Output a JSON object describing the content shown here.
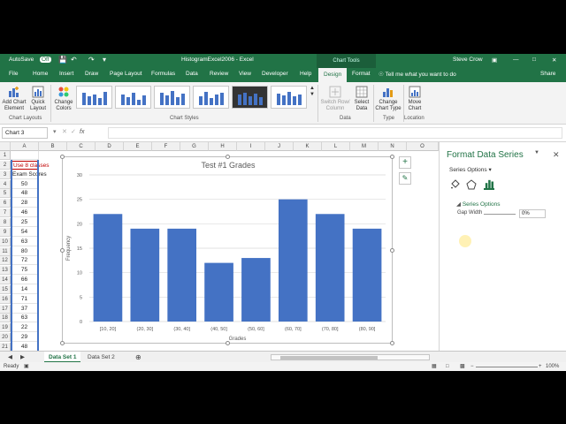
{
  "window": {
    "autosave": "AutoSave",
    "autosave_state": "Off",
    "title": "HistogramExcel2006  -  Excel",
    "chart_tools": "Chart Tools",
    "user": "Steve Crow"
  },
  "tabs": [
    "File",
    "Home",
    "Insert",
    "Draw",
    "Page Layout",
    "Formulas",
    "Data",
    "Review",
    "View",
    "Developer",
    "Help",
    "Design",
    "Format"
  ],
  "active_tab": "Design",
  "tell_me": "Tell me what you want to do",
  "share": "Share",
  "ribbon": {
    "add_chart_element": "Add Chart Element",
    "quick_layout": "Quick Layout",
    "change_colors": "Change Colors",
    "switch_row_col": "Switch Row/ Column",
    "select_data": "Select Data",
    "change_chart_type": "Change Chart Type",
    "move_chart": "Move Chart",
    "groups": {
      "chart_layouts": "Chart Layouts",
      "chart_styles": "Chart Styles",
      "data": "Data",
      "type": "Type",
      "location": "Location"
    }
  },
  "formula_bar": {
    "name_box": "Chart 3",
    "fx": "fx",
    "content": ""
  },
  "columns": [
    "A",
    "B",
    "C",
    "D",
    "E",
    "F",
    "G",
    "H",
    "I",
    "J",
    "K",
    "L",
    "M",
    "N",
    "O"
  ],
  "rows": [
    "1",
    "2",
    "3",
    "4",
    "5",
    "6",
    "7",
    "8",
    "9",
    "10",
    "11",
    "12",
    "13",
    "14",
    "15",
    "16",
    "17",
    "18",
    "19",
    "20",
    "21",
    "22"
  ],
  "cells": {
    "a2": "Use 8 classes",
    "a3": "Exam Scores",
    "scores": [
      "50",
      "48",
      "28",
      "46",
      "25",
      "54",
      "63",
      "80",
      "72",
      "75",
      "66",
      "14",
      "71",
      "37",
      "63",
      "22",
      "29",
      "48",
      "31"
    ]
  },
  "chart_data": {
    "type": "bar",
    "title": "Test #1 Grades",
    "xlabel": "Grades",
    "ylabel": "Frequency",
    "categories": [
      "[10, 20]",
      "(20, 30]",
      "(30, 40]",
      "(40, 50]",
      "(50, 60]",
      "(60, 70]",
      "(70, 80]",
      "(80, 90]"
    ],
    "values": [
      22,
      19,
      19,
      12,
      13,
      25,
      22,
      19
    ],
    "ylim": [
      0,
      30
    ],
    "yticks": [
      "0",
      "5",
      "10",
      "15",
      "20",
      "25",
      "30"
    ],
    "grid": true,
    "color": "#4472c4"
  },
  "pane": {
    "title": "Format Data Series",
    "series_options": "Series Options",
    "section": "Series Options",
    "gap_width_label": "Gap Width",
    "gap_width_value": "0%"
  },
  "sheets": [
    "Data Set 1",
    "Data Set 2"
  ],
  "active_sheet": "Data Set 1",
  "status": {
    "ready": "Ready",
    "zoom": "100%"
  }
}
